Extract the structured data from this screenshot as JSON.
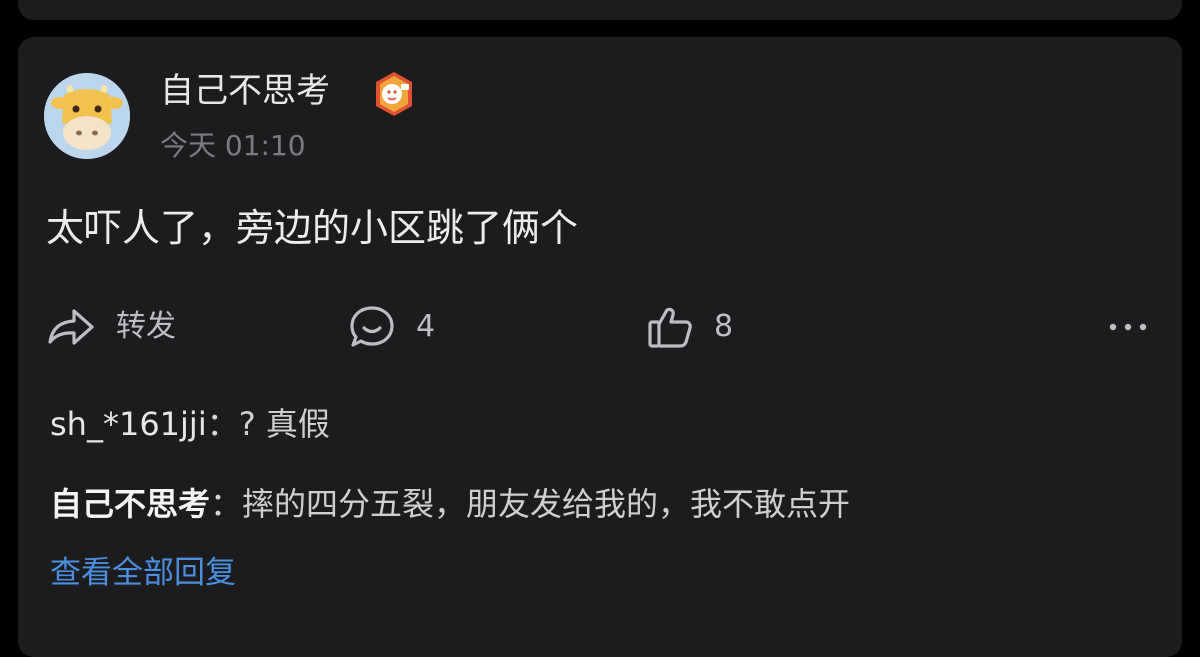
{
  "post": {
    "author": "自己不思考",
    "time": "今天 01:10",
    "text": "太吓人了，旁边的小区跳了俩个",
    "actions": {
      "share_label": "转发",
      "comment_count": "4",
      "like_count": "8"
    }
  },
  "replies": [
    {
      "author": "sh_*161jji",
      "separator": "：",
      "text": "? 真假"
    },
    {
      "author": "自己不思考",
      "separator": "：",
      "text": "摔的四分五裂，朋友发给我的，我不敢点开"
    }
  ],
  "view_all_label": "查看全部回复",
  "icons": {
    "share": "share-arrow-icon",
    "comment": "comment-bubble-icon",
    "like": "thumbs-up-icon",
    "more": "more-dots-icon",
    "badge": "level-badge-icon",
    "avatar": "cow-avatar"
  },
  "colors": {
    "background": "#000000",
    "card": "#1c1c1e",
    "primary_text": "#ececec",
    "secondary_text": "#7b7b80",
    "link": "#4a8fe0"
  }
}
